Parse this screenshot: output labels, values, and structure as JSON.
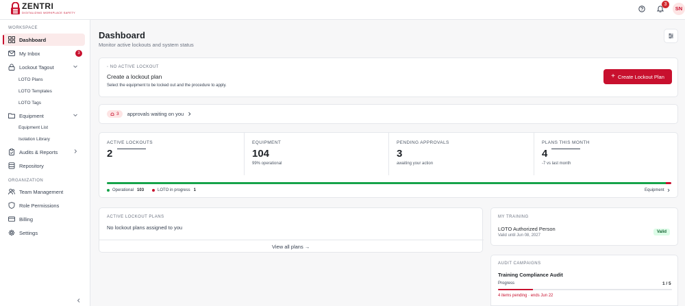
{
  "brand": {
    "name": "ZENTRI",
    "tagline": "DIGITALIZING WORKPLACE SAFETY",
    "accent": "#c8102e"
  },
  "header": {
    "help_icon": "help-circle-icon",
    "notifications_icon": "bell-icon",
    "notification_count": "3",
    "avatar_initials": "SN"
  },
  "sidebar": {
    "workspace_label": "WORKSPACE",
    "organization_label": "ORGANIZATION",
    "items": {
      "dashboard": "Dashboard",
      "inbox": "My Inbox",
      "inbox_badge": "3",
      "lockout_tagout": "Lockout Tagout",
      "loto_plans": "LOTO Plans",
      "loto_templates": "LOTO Templates",
      "loto_tags": "LOTO Tags",
      "equipment": "Equipment",
      "equipment_list": "Equipment List",
      "isolation_library": "Isolation Library",
      "audits_reports": "Audits & Reports",
      "repository": "Repository",
      "team_management": "Team Management",
      "role_permissions": "Role Permissions",
      "billing": "Billing",
      "settings": "Settings"
    }
  },
  "main": {
    "title": "Dashboard",
    "subtitle": "Monitor active lockouts and system status",
    "lockout": {
      "status": "NO ACTIVE LOCKOUT",
      "title": "Create a lockout plan",
      "description": "Select the equipment to be locked out and the procedure to apply.",
      "button": "Create Lockout Plan"
    },
    "approvals": {
      "count": "3",
      "text": "approvals waiting on you"
    },
    "stats": [
      {
        "label": "ACTIVE LOCKOUTS",
        "value": "2",
        "sub": ""
      },
      {
        "label": "EQUIPMENT",
        "value": "104",
        "sub": "99% operational"
      },
      {
        "label": "PENDING APPROVALS",
        "value": "3",
        "sub": "awaiting your action"
      },
      {
        "label": "PLANS THIS MONTH",
        "value": "4",
        "sub": "-7 vs last month"
      }
    ],
    "equipment_status": {
      "operational_label": "Operational",
      "operational_value": "103",
      "loto_label": "LOTO in progress",
      "loto_value": "1",
      "operational_fraction": 0.99,
      "link": "Equipment"
    },
    "active_plans": {
      "heading": "ACTIVE LOCKOUT PLANS",
      "empty": "No lockout plans assigned to you",
      "view_all": "View all plans →"
    },
    "training": {
      "heading": "MY TRAINING",
      "title": "LOTO Authorized Person",
      "valid_until": "Valid until Jun 08, 2027",
      "badge": "Valid"
    },
    "audit": {
      "heading": "AUDIT CAMPAIGNS",
      "title": "Training Compliance Audit",
      "progress_label": "Progress",
      "progress_value": "1 / 5",
      "progress_fraction": 0.2,
      "note": "4 items pending · ends Jun 22"
    }
  },
  "colors": {
    "accent": "#c8102e",
    "success": "#16a34a",
    "sidebar_active_bg": "#fbeaea",
    "valid_bg": "#dcfce7"
  }
}
